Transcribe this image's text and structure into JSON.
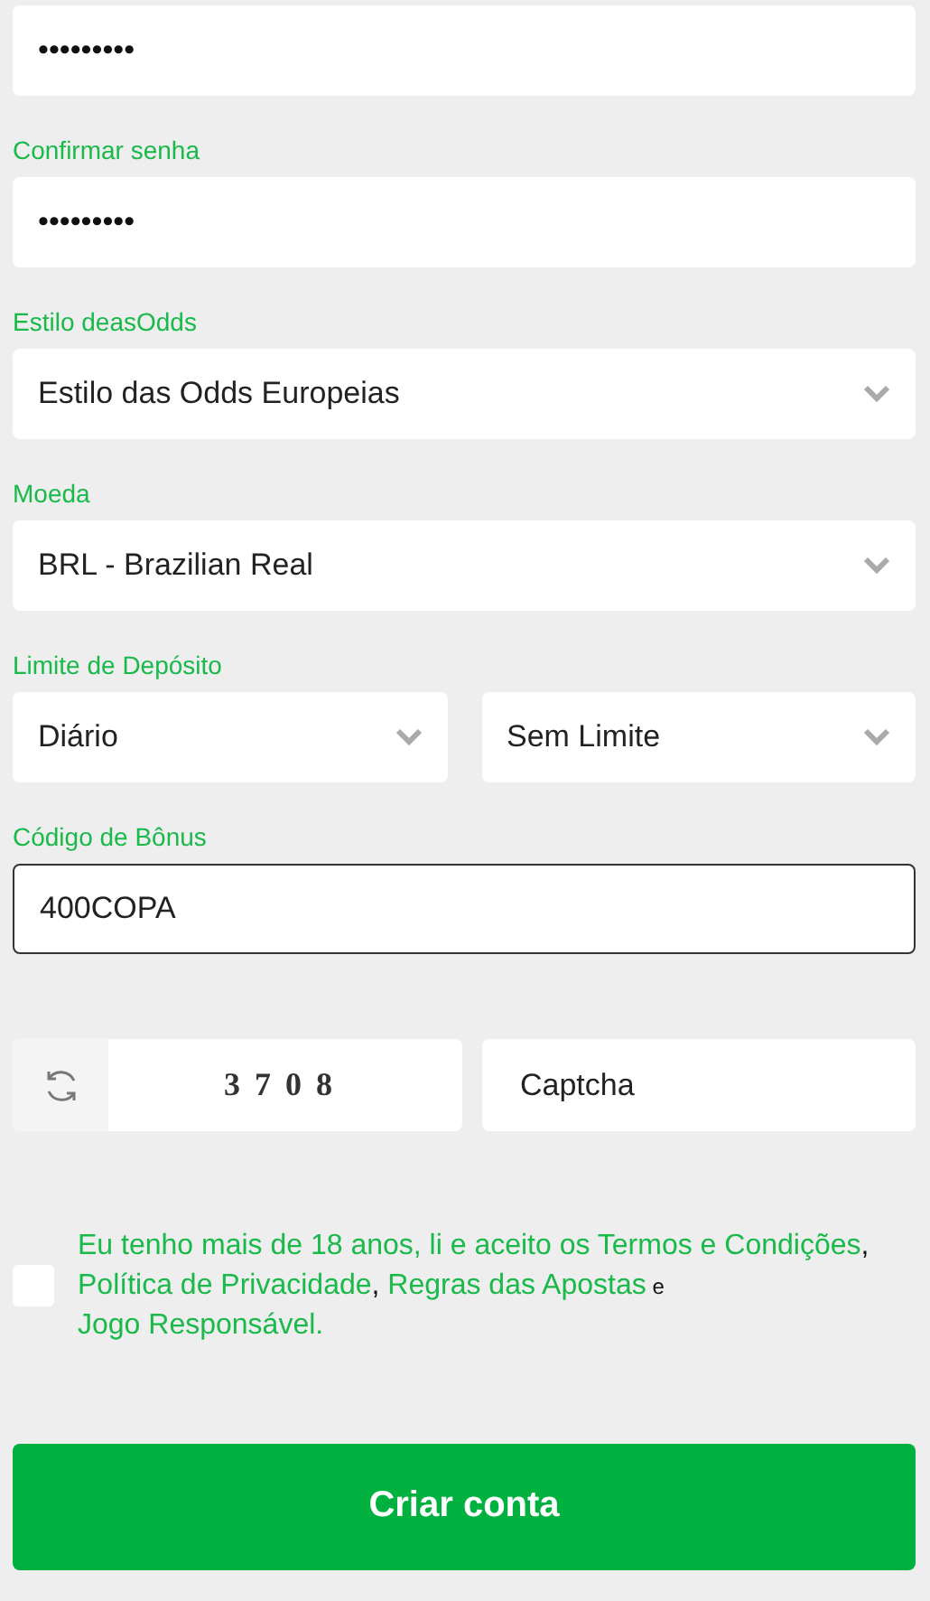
{
  "fields": [
    {
      "kind": "password",
      "value": "•••••••••"
    },
    {
      "kind": "password",
      "label": "Confirmar senha",
      "value": "•••••••••"
    },
    {
      "kind": "select",
      "label": "Estilo deasOdds",
      "value": "Estilo das Odds Europeias"
    },
    {
      "kind": "select",
      "label": "Moeda",
      "value": "BRL - Brazilian Real"
    },
    {
      "kind": "select_pair",
      "label": "Limite de Depósito",
      "values": [
        "Diário",
        "Sem Limite"
      ]
    },
    {
      "kind": "text",
      "label": "Código de Bônus",
      "value": "400COPA",
      "focused": true
    }
  ],
  "captcha": {
    "code": "3708",
    "placeholder": "Captcha"
  },
  "terms": {
    "checked": false,
    "segments": [
      {
        "kind": "text",
        "text": "Eu tenho mais de 18 anos, li e aceito os "
      },
      {
        "kind": "link",
        "text": "Termos e Condições"
      },
      {
        "kind": "plain",
        "text": ", "
      },
      {
        "kind": "link",
        "text": "Política de Privacidade"
      },
      {
        "kind": "plain",
        "text": ", "
      },
      {
        "kind": "link",
        "text": "Regras das Apostas"
      },
      {
        "kind": "small",
        "text": " e "
      },
      {
        "kind": "link",
        "text": "Jogo Responsável."
      }
    ]
  },
  "submit": "Criar conta"
}
